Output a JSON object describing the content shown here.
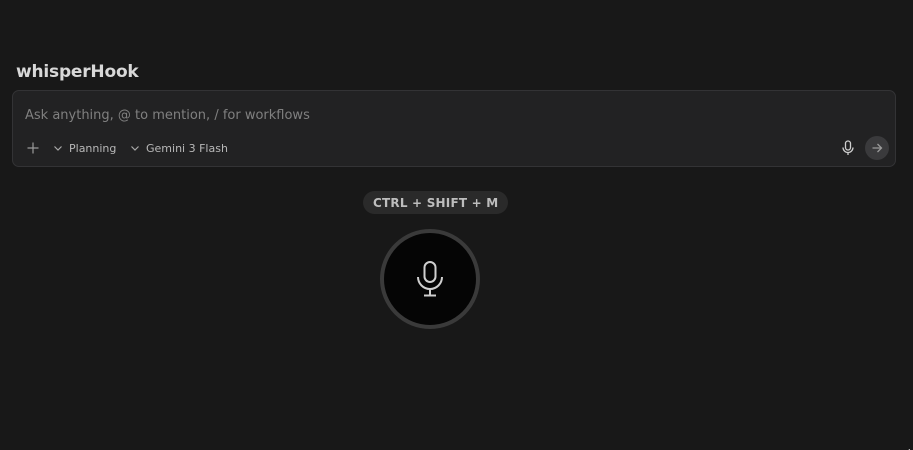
{
  "app": {
    "title": "whisperHook"
  },
  "composer": {
    "placeholder": "Ask anything, @ to mention, / for workflows",
    "value": "",
    "mode_label": "Planning",
    "model_label": "Gemini 3 Flash",
    "icons": {
      "add": "plus-icon",
      "dropdown": "chevron-down-icon",
      "voice": "microphone-icon",
      "send": "arrow-right-icon"
    }
  },
  "recorder": {
    "shortcut": "CTRL + SHIFT + M",
    "icon": "microphone-icon"
  },
  "colors": {
    "background": "#181818",
    "panel": "#222223",
    "accent_ring": "#3a3a3a"
  }
}
